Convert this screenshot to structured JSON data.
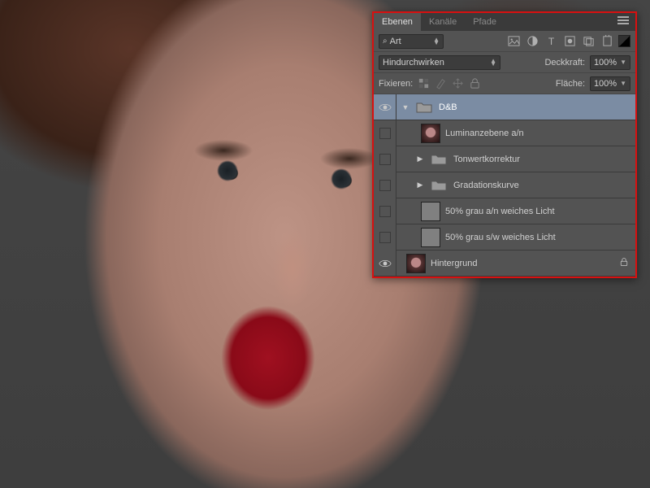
{
  "tabs": {
    "layers": "Ebenen",
    "channels": "Kanäle",
    "paths": "Pfade"
  },
  "filter": {
    "label": "Art"
  },
  "iconbar": [
    "image-icon",
    "adjust-icon",
    "type-icon",
    "mask-icon",
    "transform-icon",
    "artboard-icon"
  ],
  "blend": {
    "mode": "Hindurchwirken"
  },
  "opacity": {
    "label": "Deckkraft:",
    "value": "100%"
  },
  "lockrow": {
    "label": "Fixieren:"
  },
  "fill": {
    "label": "Fläche:",
    "value": "100%"
  },
  "layers": [
    {
      "name": "D&B",
      "type": "group",
      "visible": true,
      "selected": true,
      "open": true,
      "depth": 0
    },
    {
      "name": "Luminanzebene a/n",
      "type": "layer",
      "visible": false,
      "depth": 1,
      "thumb": "portrait"
    },
    {
      "name": "Tonwertkorrektur",
      "type": "group",
      "visible": false,
      "depth": 1,
      "open": false
    },
    {
      "name": "Gradationskurve",
      "type": "group",
      "visible": false,
      "depth": 1,
      "open": false
    },
    {
      "name": "50% grau a/n weiches Licht",
      "type": "layer",
      "visible": false,
      "depth": 1,
      "thumb": "gray"
    },
    {
      "name": "50% grau s/w weiches Licht",
      "type": "layer",
      "visible": false,
      "depth": 1,
      "thumb": "gray"
    },
    {
      "name": "Hintergrund",
      "type": "layer",
      "visible": true,
      "depth": 0,
      "thumb": "portrait",
      "locked": true
    }
  ]
}
